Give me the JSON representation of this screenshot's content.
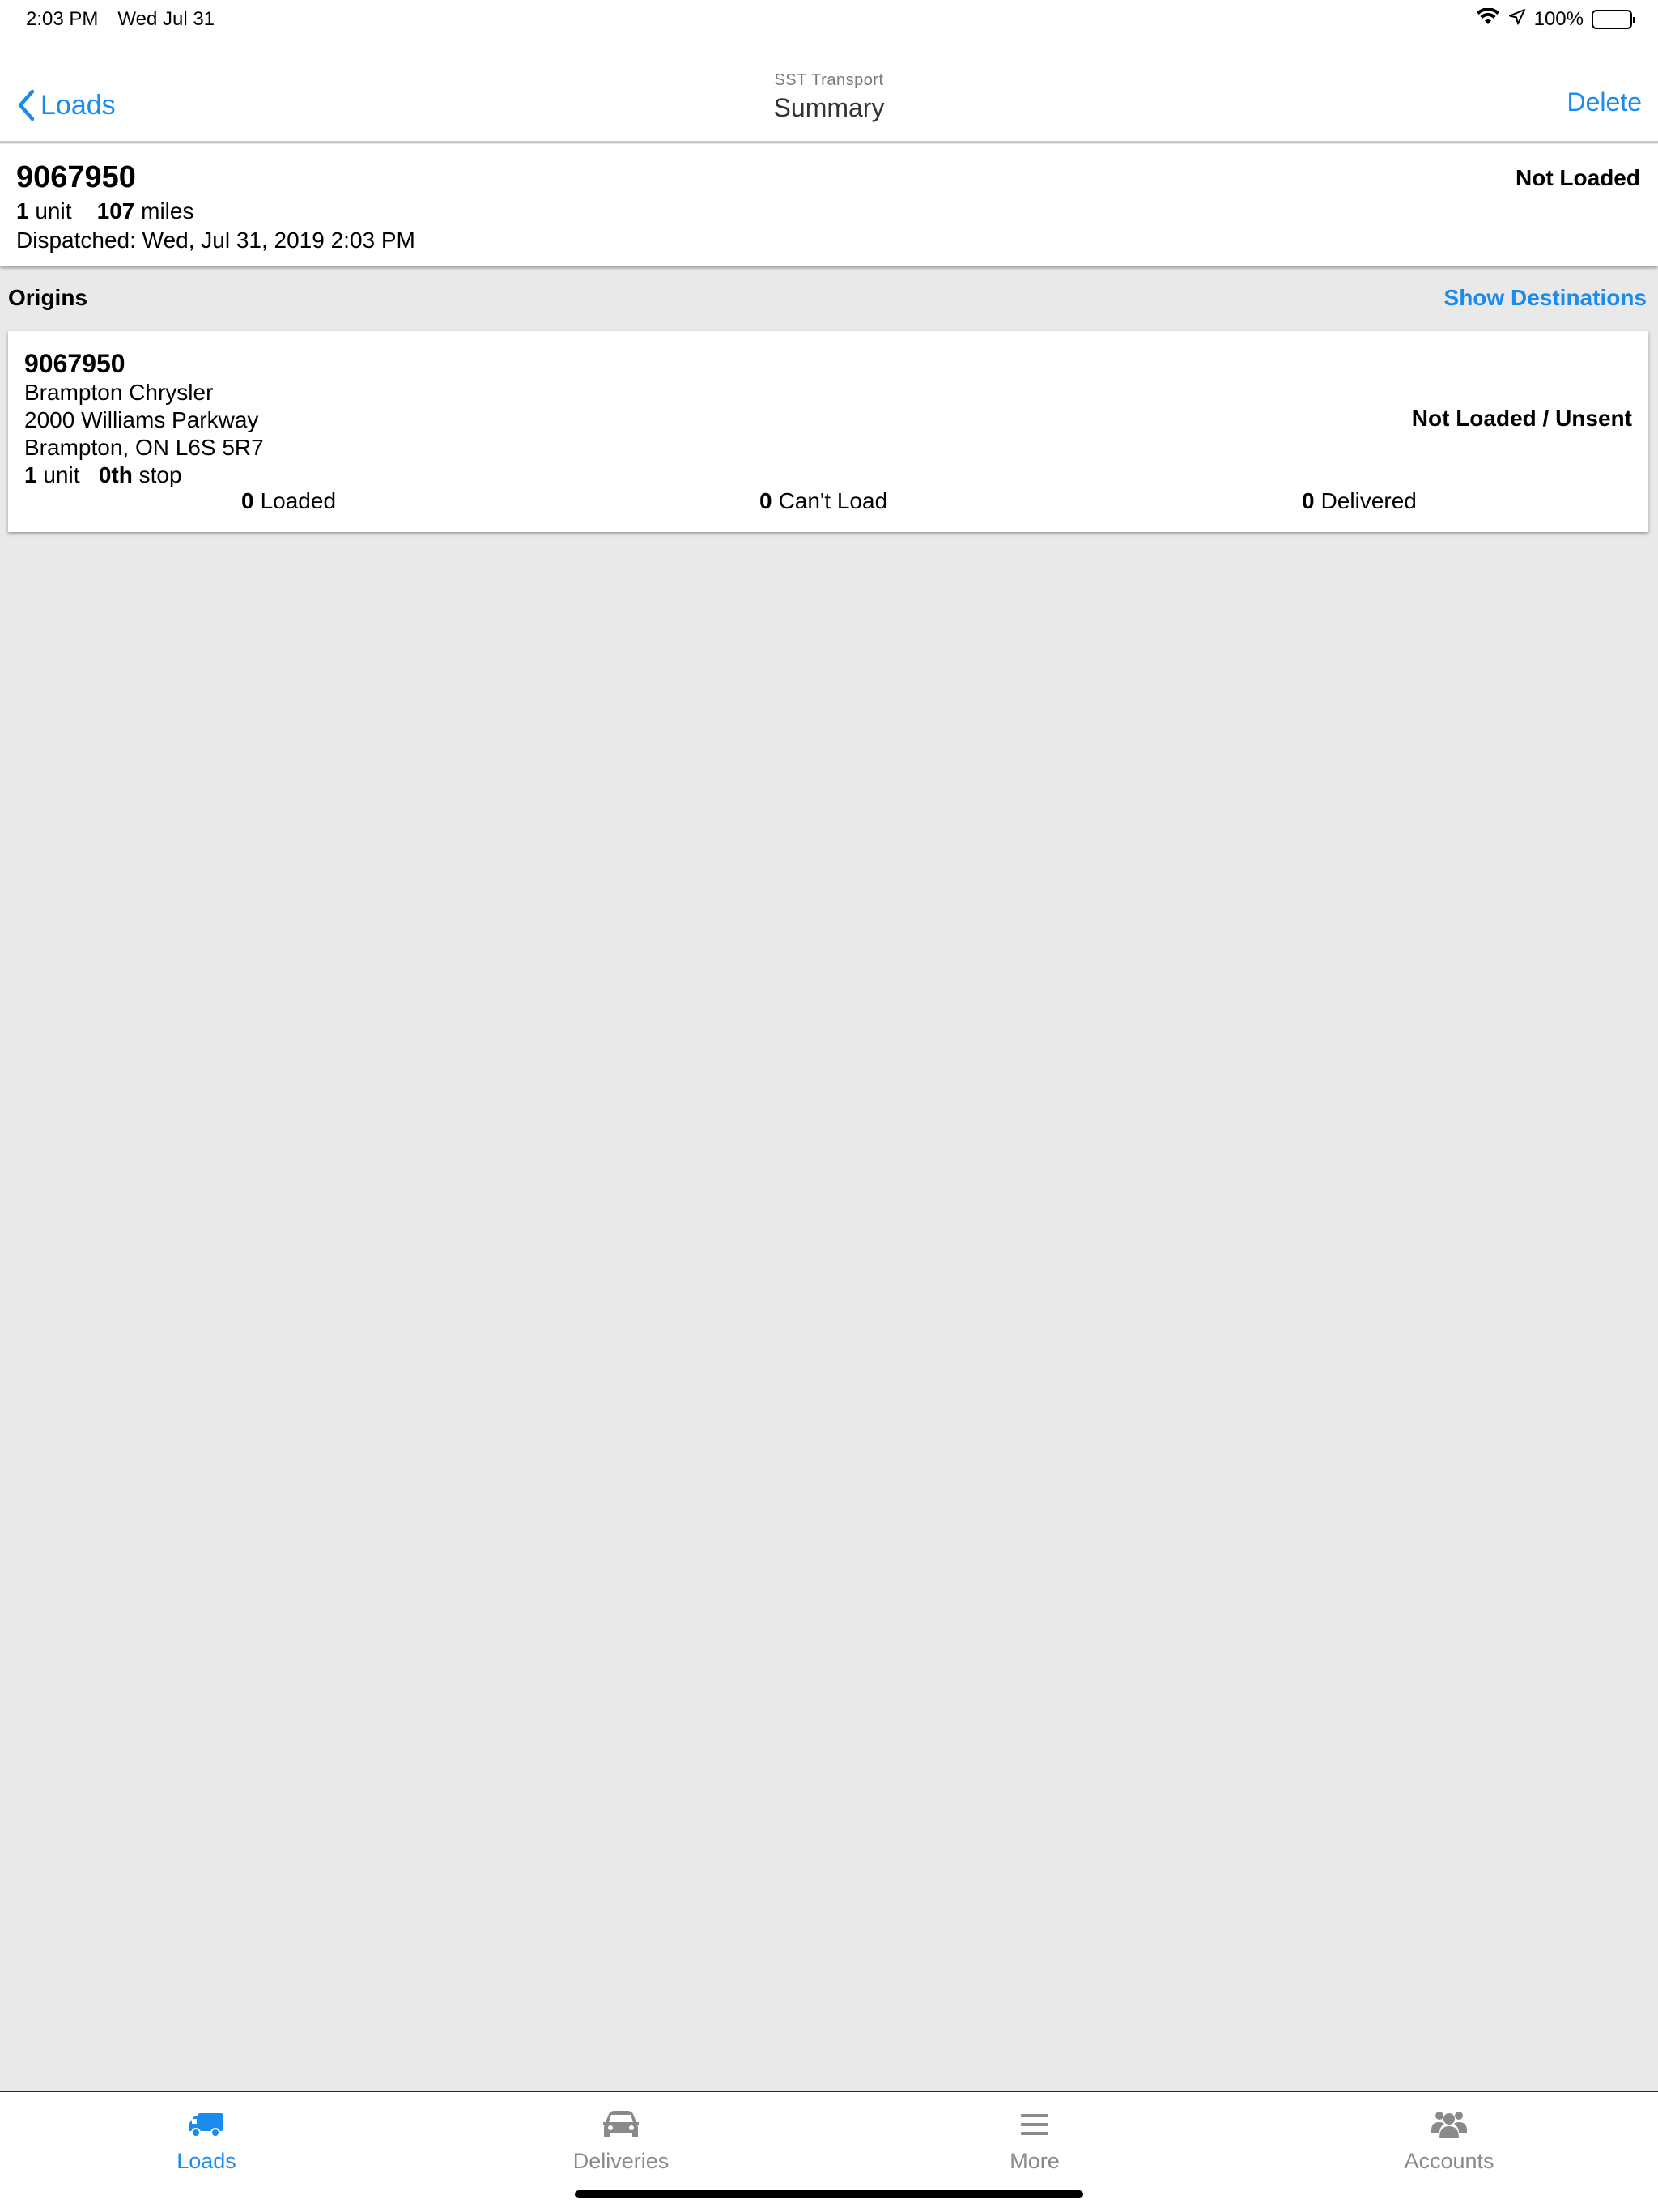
{
  "status_bar": {
    "time": "2:03 PM",
    "date": "Wed Jul 31",
    "battery": "100%"
  },
  "nav": {
    "back_label": "Loads",
    "subtitle": "SST Transport",
    "title": "Summary",
    "delete_label": "Delete"
  },
  "load": {
    "number": "9067950",
    "units": "1",
    "units_label": "unit",
    "miles": "107",
    "miles_label": "miles",
    "dispatched": "Dispatched: Wed, Jul 31, 2019 2:03 PM",
    "status": "Not Loaded"
  },
  "section": {
    "title": "Origins",
    "action": "Show Destinations"
  },
  "origin": {
    "number": "9067950",
    "name": "Brampton Chrysler",
    "street": "2000 Williams Parkway",
    "city": "Brampton, ON L6S 5R7",
    "units": "1",
    "units_label": "unit",
    "stop": "0th",
    "stop_label": "stop",
    "status": "Not Loaded / Unsent",
    "loaded_count": "0",
    "loaded_label": "Loaded",
    "cant_load_count": "0",
    "cant_load_label": "Can't Load",
    "delivered_count": "0",
    "delivered_label": "Delivered"
  },
  "tabs": [
    {
      "label": "Loads",
      "icon": "truck-icon",
      "active": true
    },
    {
      "label": "Deliveries",
      "icon": "car-icon",
      "active": false
    },
    {
      "label": "More",
      "icon": "menu-icon",
      "active": false
    },
    {
      "label": "Accounts",
      "icon": "users-icon",
      "active": false
    }
  ],
  "colors": {
    "accent": "#1a8cf0",
    "inactive": "#8a8a8a",
    "background": "#e9e9e9"
  }
}
